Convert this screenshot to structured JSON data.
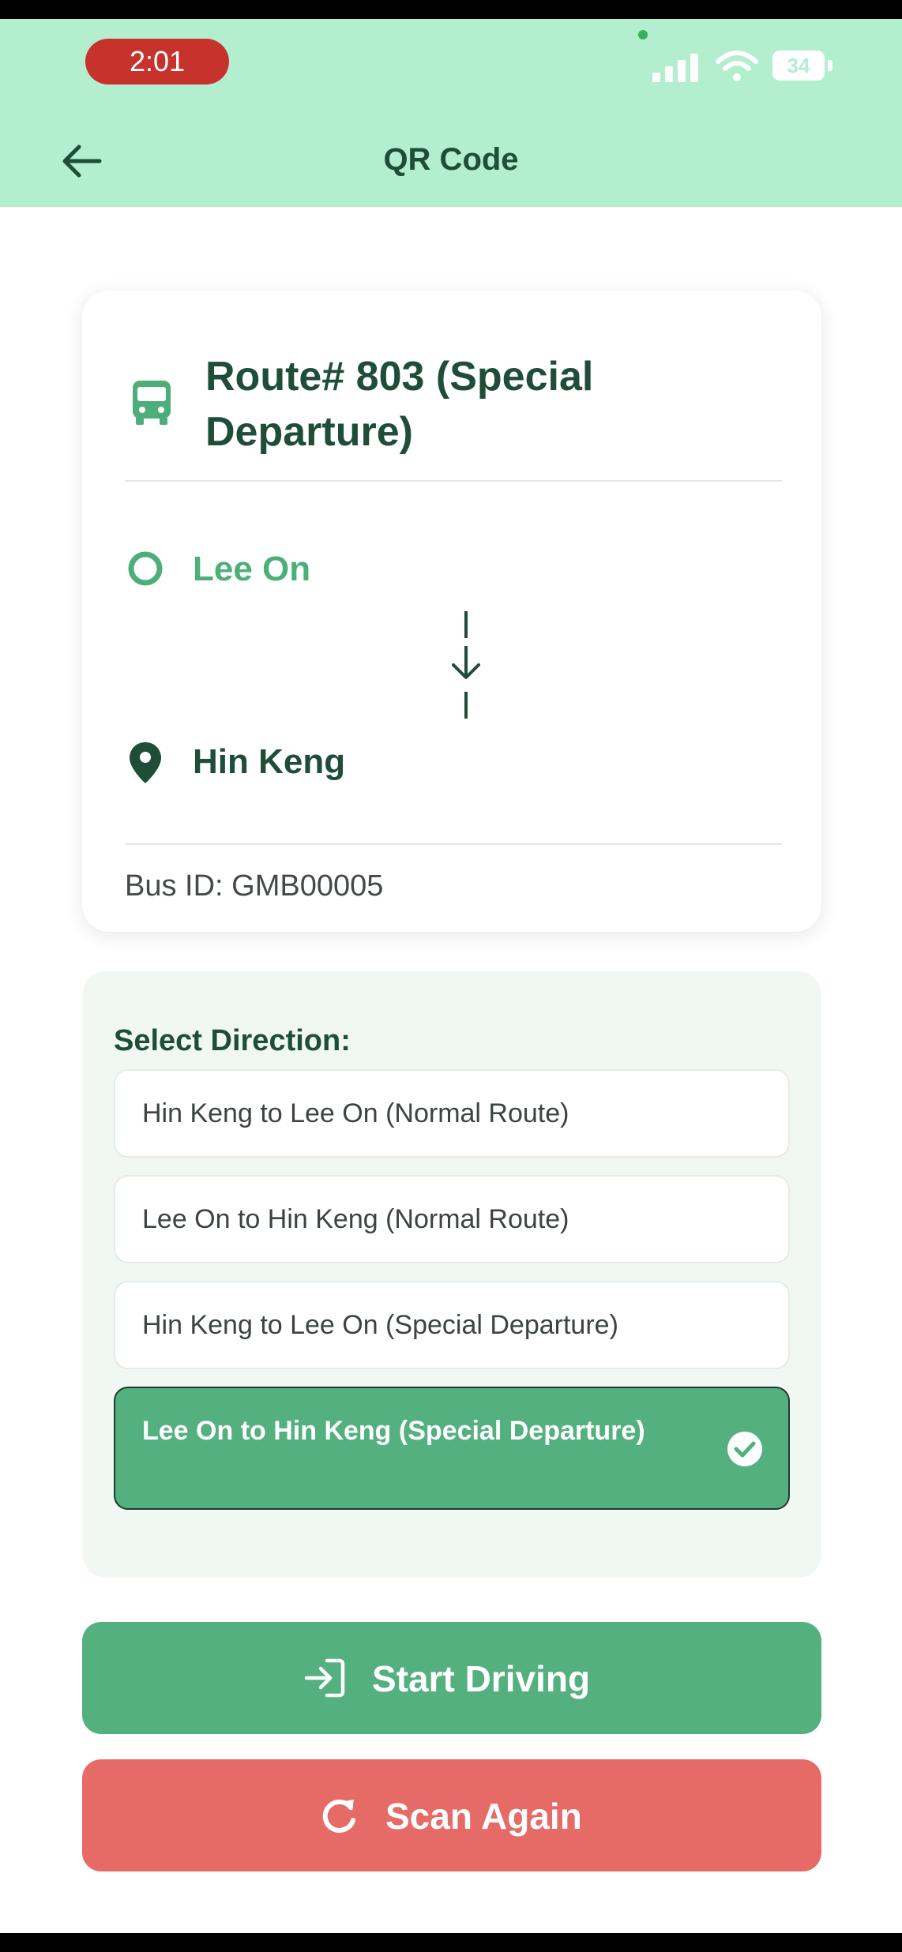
{
  "status_bar": {
    "time": "2:01",
    "battery": "34"
  },
  "header": {
    "title": "QR Code"
  },
  "route_card": {
    "route_title": "Route# 803 (Special Departure)",
    "origin": "Lee On",
    "destination": "Hin Keng",
    "bus_id": "Bus ID: GMB00005"
  },
  "direction": {
    "heading": "Select Direction:",
    "options": [
      {
        "label": "Hin Keng to Lee On (Normal Route)",
        "selected": false
      },
      {
        "label": "Lee On to Hin Keng (Normal Route)",
        "selected": false
      },
      {
        "label": "Hin Keng to Lee On (Special Departure)",
        "selected": false
      },
      {
        "label": "Lee On to Hin Keng (Special Departure)",
        "selected": true
      }
    ]
  },
  "actions": {
    "start_label": "Start Driving",
    "scan_label": "Scan Again"
  },
  "icons": {
    "back": "arrow-left-icon",
    "bus": "bus-icon",
    "origin": "circle-outline-icon",
    "destination": "map-pin-icon",
    "connector": "arrow-down-icon",
    "selected": "check-circle-icon",
    "start": "log-in-icon",
    "scan": "refresh-icon"
  },
  "colors": {
    "header_bg": "#b3eecf",
    "primary_green": "#54b07e",
    "dark_green": "#1e4d38",
    "danger_red": "#e66a66",
    "panel_bg": "#f1f8f4"
  }
}
